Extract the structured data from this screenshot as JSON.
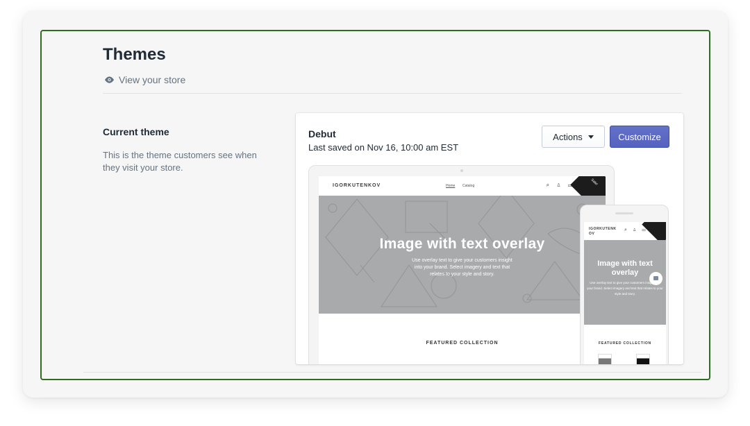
{
  "header": {
    "title": "Themes",
    "view_store_label": "View your store"
  },
  "current_theme_section": {
    "title": "Current theme",
    "description": "This is the theme customers see when they visit your store."
  },
  "theme_card": {
    "name": "Debut",
    "last_saved": "Last saved on Nov 16, 10:00 am EST",
    "actions_label": "Actions",
    "customize_label": "Customize"
  },
  "preview": {
    "store_name": "IGORKUTENKOV",
    "nav_home": "Home",
    "nav_catalog": "Catalog",
    "ribbon_text": "Sale!",
    "hero_title": "Image with text overlay",
    "hero_subtitle": "Use overlay text to give your customers insight into your brand. Select imagery and text that relates to your style and story.",
    "featured_heading": "FEATURED COLLECTION",
    "mobile_store_name": "IGORKUTENK OV",
    "mobile_hero_subtitle": "Use overlay text to give your customers insight into your brand. Select imagery and text that relates to your style and story."
  },
  "colors": {
    "primary_button": "#5c6ac4",
    "frame_border": "#2a6e1e",
    "hero_background": "#a9aaac"
  }
}
